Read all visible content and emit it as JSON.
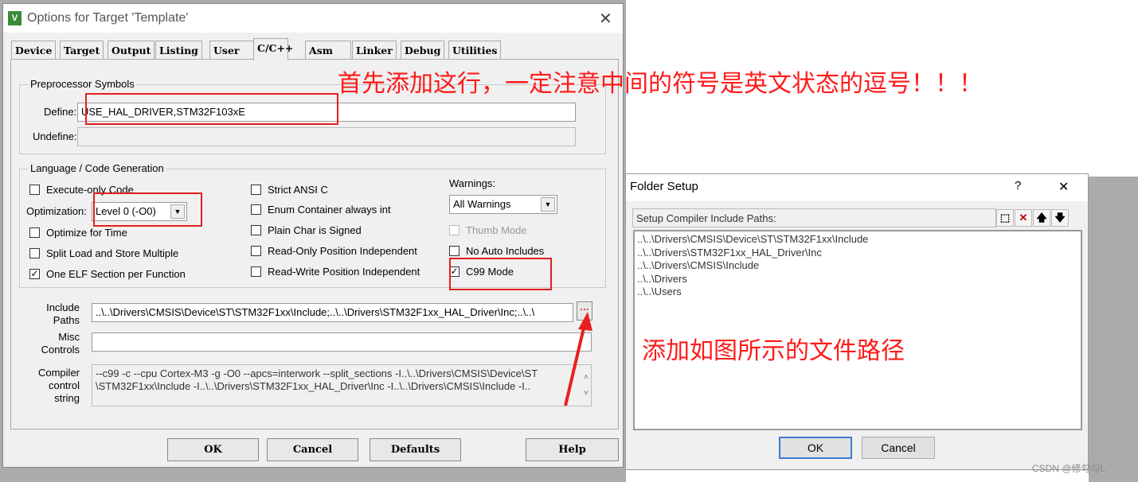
{
  "options_dialog": {
    "title": "Options for Target 'Template'",
    "tabs": [
      "Device",
      "Target",
      "Output",
      "Listing",
      "User",
      "C/C++",
      "Asm",
      "Linker",
      "Debug",
      "Utilities"
    ],
    "selected_tab": "C/C++",
    "preprocessor": {
      "group": "Preprocessor Symbols",
      "define_label": "Define:",
      "define_value": "USE_HAL_DRIVER,STM32F103xE",
      "undefine_label": "Undefine:",
      "undefine_value": ""
    },
    "language": {
      "group": "Language / Code Generation",
      "execute_only": "Execute-only Code",
      "optimization_label": "Optimization:",
      "optimization_value": "Level 0 (-O0)",
      "optimize_time": "Optimize for Time",
      "split_load": "Split Load and Store Multiple",
      "one_elf": "One ELF Section per Function",
      "strict_ansi": "Strict ANSI C",
      "enum_container": "Enum Container always int",
      "plain_char": "Plain Char is Signed",
      "ro_pi": "Read-Only Position Independent",
      "rw_pi": "Read-Write Position Independent",
      "warnings_label": "Warnings:",
      "warnings_value": "All Warnings",
      "thumb_mode": "Thumb Mode",
      "no_auto": "No Auto Includes",
      "c99": "C99 Mode",
      "checked": {
        "one_elf": true,
        "c99": true
      }
    },
    "include_label": "Include Paths",
    "include_value": "..\\..\\Drivers\\CMSIS\\Device\\ST\\STM32F1xx\\Include;..\\..\\Drivers\\STM32F1xx_HAL_Driver\\Inc;..\\..\\",
    "browse": "...",
    "misc_label": "Misc Controls",
    "misc_value": "",
    "compiler_label": "Compiler control string",
    "compiler_line1": "--c99 -c --cpu Cortex-M3 -g -O0 --apcs=interwork --split_sections -I..\\..\\Drivers\\CMSIS\\Device\\ST",
    "compiler_line2": "\\STM32F1xx\\Include -I..\\..\\Drivers\\STM32F1xx_HAL_Driver\\Inc -I..\\..\\Drivers\\CMSIS\\Include -I..",
    "buttons": {
      "ok": "OK",
      "cancel": "Cancel",
      "defaults": "Defaults",
      "help": "Help"
    }
  },
  "folder_setup": {
    "title": "Folder Setup",
    "help": "?",
    "close": "✕",
    "header": "Setup Compiler Include Paths:",
    "paths": [
      "..\\..\\Drivers\\CMSIS\\Device\\ST\\STM32F1xx\\Include",
      "..\\..\\Drivers\\STM32F1xx_HAL_Driver\\Inc",
      "..\\..\\Drivers\\CMSIS\\Include",
      "..\\..\\Drivers",
      "..\\..\\Users"
    ],
    "ok": "OK",
    "cancel": "Cancel"
  },
  "annotations": {
    "note1": "首先添加这行，一定注意中间的符号是英文状态的逗号！！！",
    "note2": "添加如图所示的文件路径",
    "color": "#ff1a1a"
  },
  "watermark": "CSDN @修勾勾L"
}
